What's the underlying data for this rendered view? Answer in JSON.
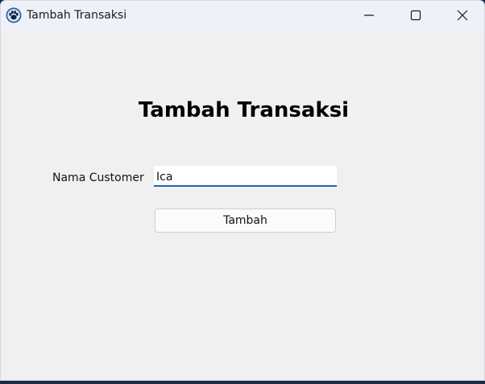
{
  "window": {
    "title": "Tambah Transaksi",
    "icon": "paw-icon"
  },
  "form": {
    "heading": "Tambah Transaksi",
    "customer_label": "Nama Customer",
    "customer_value": "Ica",
    "submit_label": "Tambah"
  },
  "colors": {
    "background": "#f0f0f0",
    "titlebar": "#eef1f8",
    "input_focus_accent": "#1b63b8"
  }
}
